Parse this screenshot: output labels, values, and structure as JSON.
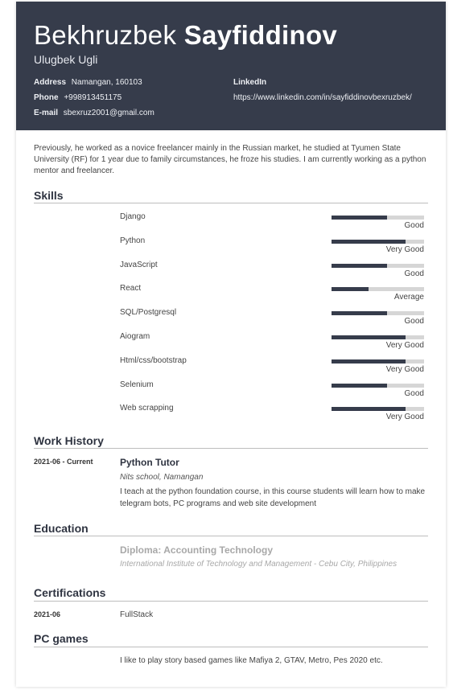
{
  "header": {
    "first_name": "Bekhruzbek",
    "last_name": "Sayfiddinov",
    "subtitle": "Ulugbek Ugli",
    "address_label": "Address",
    "address": "Namangan, 160103",
    "phone_label": "Phone",
    "phone": "+998913451175",
    "email_label": "E-mail",
    "email": "sbexruz2001@gmail.com",
    "linkedin_label": "LinkedIn",
    "linkedin_url": "https://www.linkedin.com/in/sayfiddinovbexruzbek/"
  },
  "summary": "Previously, he worked as a novice freelancer mainly in the Russian market, he studied at Tyumen State University (RF) for 1 year due to family circumstances, he froze his studies. I am currently working as a python mentor and freelancer.",
  "skills": {
    "title": "Skills",
    "items": [
      {
        "name": "Django",
        "level": "Good",
        "fraction": 0.6
      },
      {
        "name": "Python",
        "level": "Very Good",
        "fraction": 0.8
      },
      {
        "name": "JavaScript",
        "level": "Good",
        "fraction": 0.6
      },
      {
        "name": "React",
        "level": "Average",
        "fraction": 0.4
      },
      {
        "name": "SQL/Postgresql",
        "level": "Good",
        "fraction": 0.6
      },
      {
        "name": "Aiogram",
        "level": "Very Good",
        "fraction": 0.8
      },
      {
        "name": "Html/css/bootstrap",
        "level": "Very Good",
        "fraction": 0.8
      },
      {
        "name": "Selenium",
        "level": "Good",
        "fraction": 0.6
      },
      {
        "name": "Web scrapping",
        "level": "Very Good",
        "fraction": 0.8
      }
    ]
  },
  "work": {
    "title": "Work History",
    "date": "2021-06 - Current",
    "job_title": "Python Tutor",
    "company": "Nits school, Namangan",
    "description": "I teach at the python foundation course, in this course students will learn how to make telegram bots, PC programs and web site development"
  },
  "education": {
    "title": "Education",
    "degree": "Diploma: Accounting Technology",
    "school": "International Institute of Technology and Management - Cebu City, Philippines"
  },
  "certifications": {
    "title": "Certifications",
    "date": "2021-06",
    "name": "FullStack"
  },
  "games": {
    "title": "PC games",
    "text": "I like to play story based games like Mafiya 2, GTAV, Metro, Pes 2020 etc."
  },
  "colors": {
    "header_bg": "#363c4b",
    "bar_fill": "#363c4b",
    "bar_track": "#d6d6d6"
  }
}
